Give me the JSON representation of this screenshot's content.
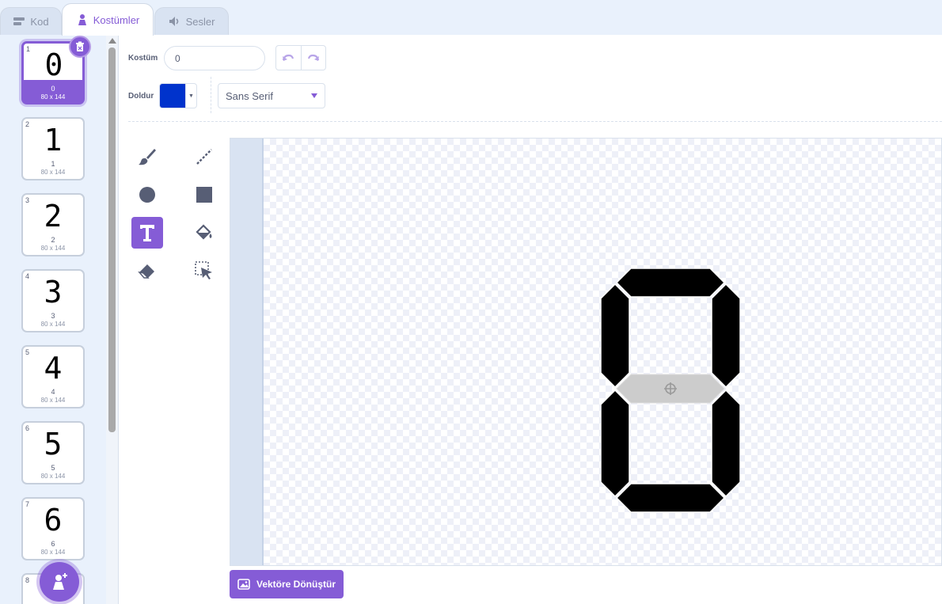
{
  "tabs": [
    {
      "label": "Kod",
      "icon": "code-icon"
    },
    {
      "label": "Kostümler",
      "icon": "costume-icon"
    },
    {
      "label": "Sesler",
      "icon": "sound-icon"
    }
  ],
  "costumes": [
    {
      "num": "1",
      "glyph": "0",
      "name": "0",
      "size": "80 x 144"
    },
    {
      "num": "2",
      "glyph": "1",
      "name": "1",
      "size": "80 x 144"
    },
    {
      "num": "3",
      "glyph": "2",
      "name": "2",
      "size": "80 x 144"
    },
    {
      "num": "4",
      "glyph": "3",
      "name": "3",
      "size": "80 x 144"
    },
    {
      "num": "5",
      "glyph": "4",
      "name": "4",
      "size": "80 x 144"
    },
    {
      "num": "6",
      "glyph": "5",
      "name": "5",
      "size": "80 x 144"
    },
    {
      "num": "7",
      "glyph": "6",
      "name": "6",
      "size": "80 x 144"
    },
    {
      "num": "8",
      "glyph": "",
      "name": "",
      "size": ""
    }
  ],
  "editor": {
    "costume_label": "Kostüm",
    "costume_name": "0",
    "fill_label": "Doldur",
    "fill_color": "#0033cc",
    "font": "Sans Serif",
    "convert_label": "Vektöre Dönüştür"
  },
  "colors": {
    "accent": "#855cd6",
    "segment_on": "#000000",
    "segment_off": "#cccccc"
  }
}
